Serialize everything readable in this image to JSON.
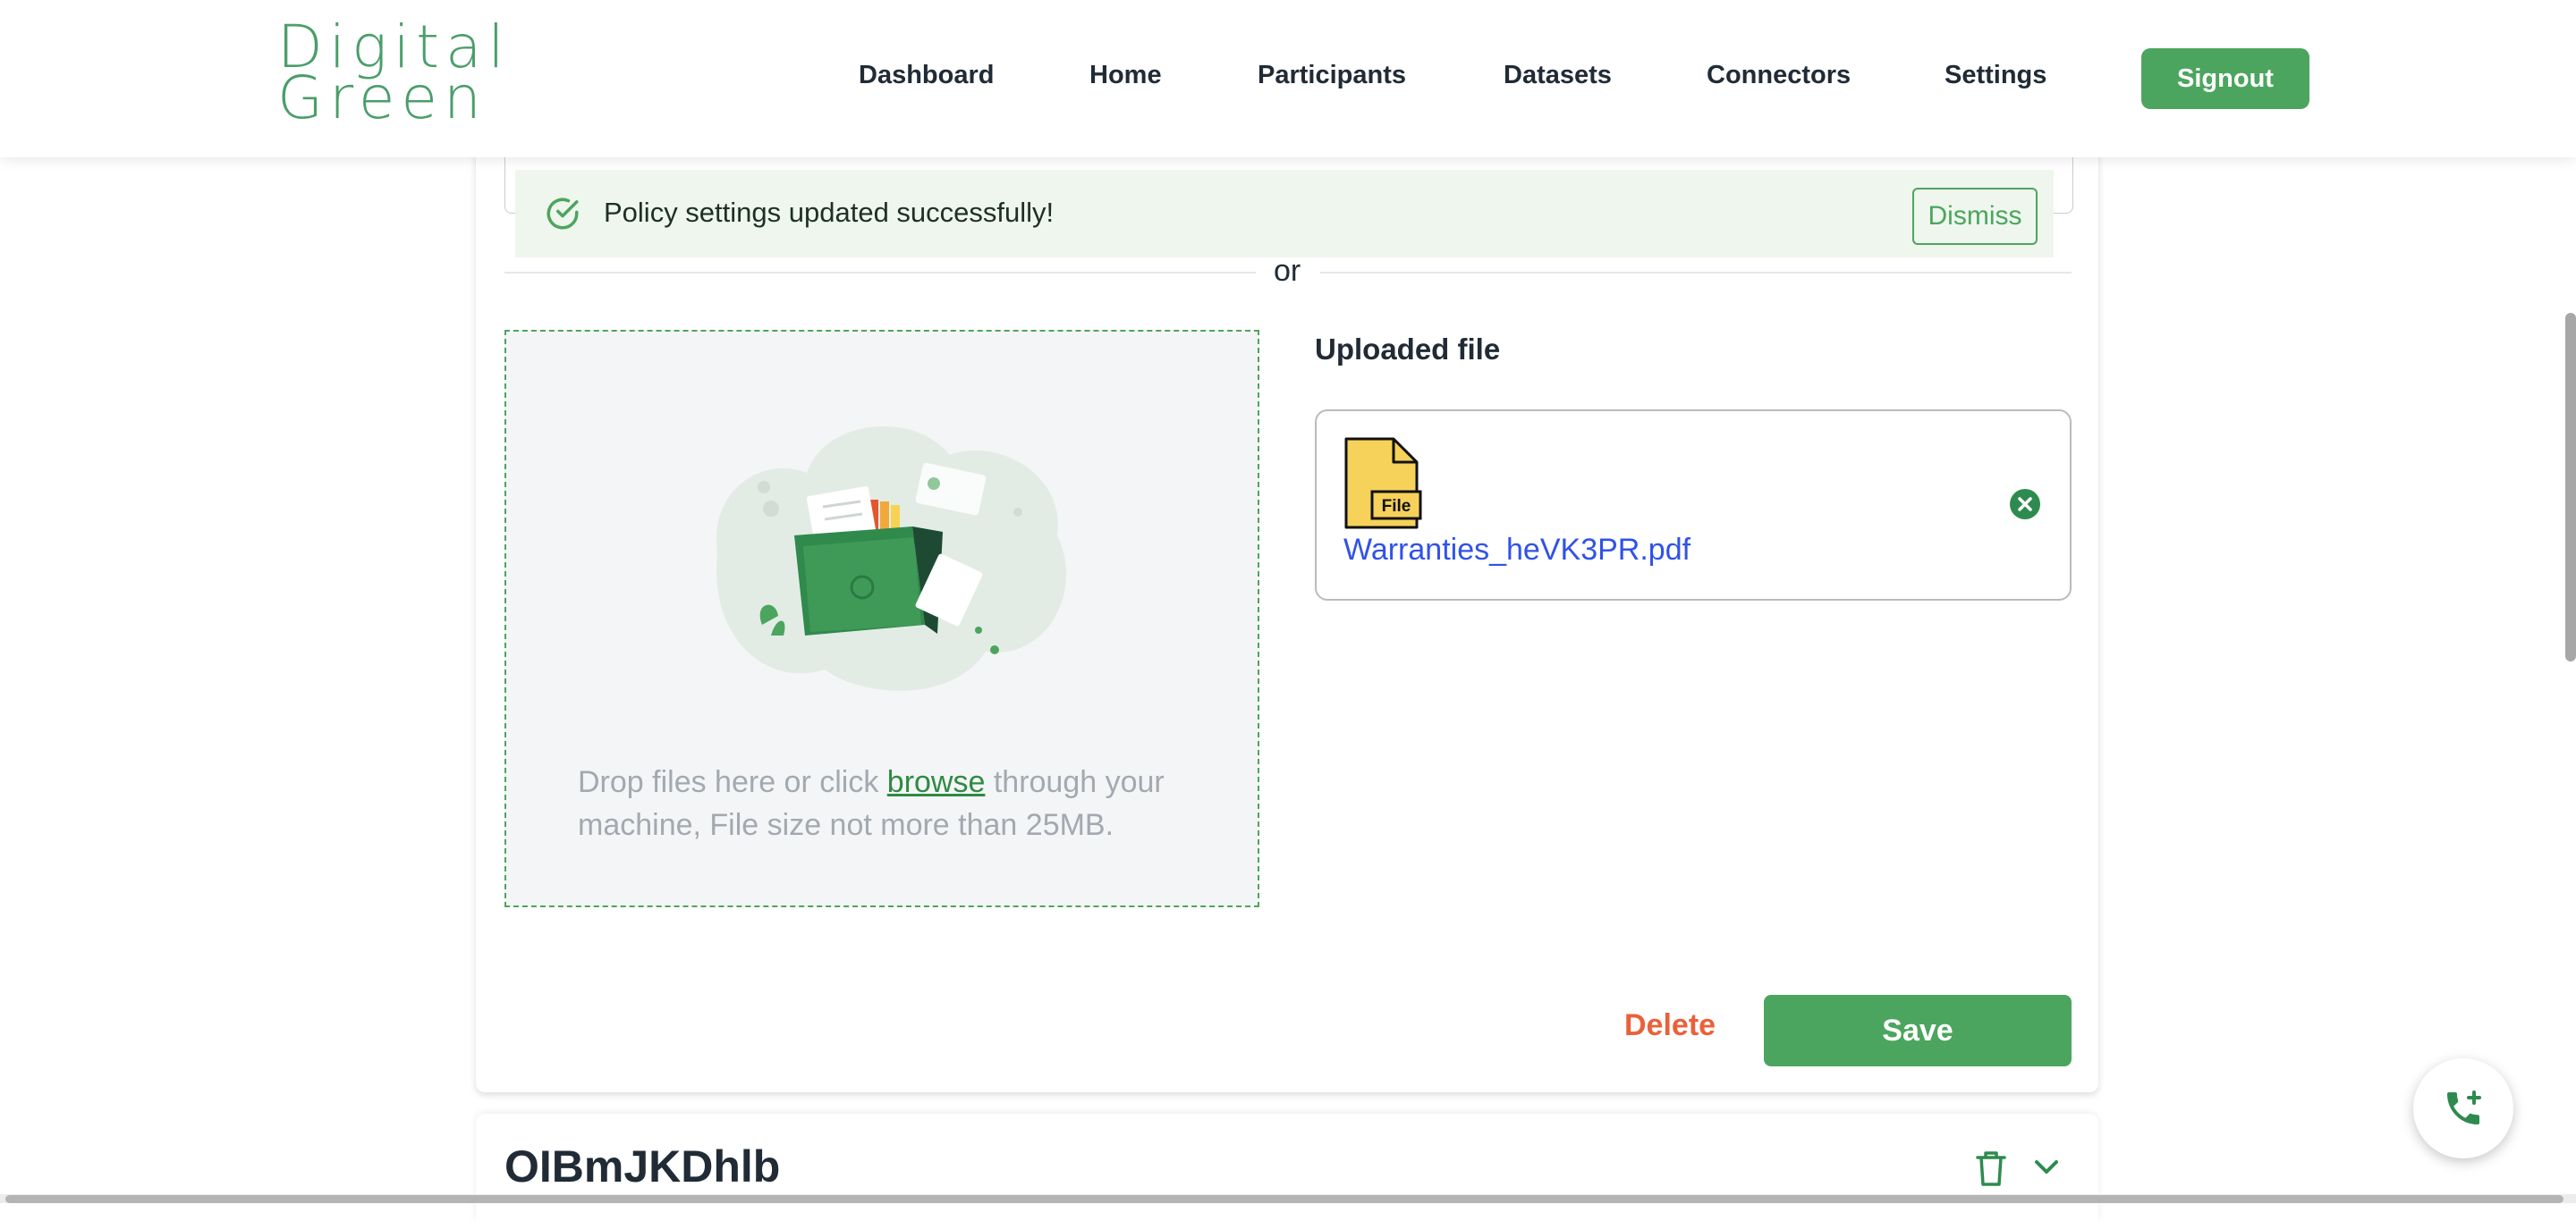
{
  "header": {
    "logo": {
      "line1": "Digital",
      "line2": "Green"
    },
    "nav": [
      {
        "label": "Dashboard"
      },
      {
        "label": "Home"
      },
      {
        "label": "Participants"
      },
      {
        "label": "Datasets"
      },
      {
        "label": "Connectors"
      },
      {
        "label": "Settings"
      }
    ],
    "signout_label": "Signout"
  },
  "toast": {
    "message": "Policy settings updated successfully!",
    "dismiss_label": "Dismiss",
    "icon": "check-circle-icon"
  },
  "divider_text": "or",
  "dropzone": {
    "text_before": "Drop files here or click ",
    "link": "browse",
    "text_after": " through your machine, File size not more than 25MB."
  },
  "uploaded": {
    "title": "Uploaded file",
    "file_icon_label": "File",
    "file_name": "Warranties_heVK3PR.pdf",
    "remove_icon": "close-circle-icon"
  },
  "actions": {
    "delete_label": "Delete",
    "save_label": "Save"
  },
  "next_policy": {
    "title": "OIBmJKDhlb",
    "icons": [
      "trash-icon",
      "chevron-down-icon"
    ]
  },
  "fab": {
    "icon": "phone-add-icon"
  },
  "colors": {
    "brand_green": "#4ca55e",
    "danger": "#e9613a",
    "link_blue": "#3152e8",
    "toast_bg": "#eef6ee"
  }
}
